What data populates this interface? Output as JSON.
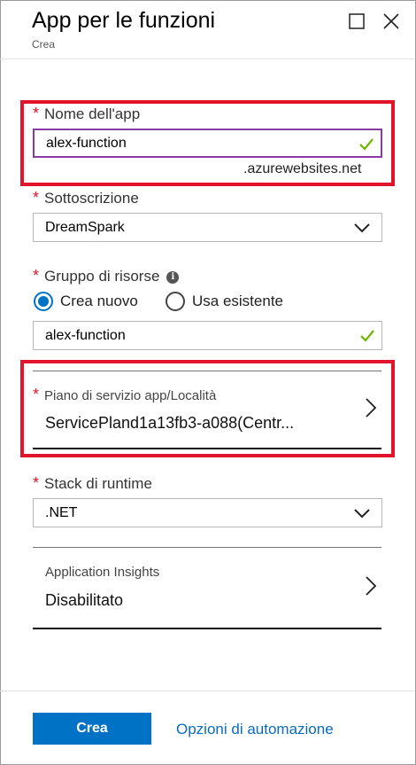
{
  "header": {
    "title": "App per le funzioni",
    "subtitle": "Crea"
  },
  "form": {
    "app_name": {
      "label": "Nome dell'app",
      "value": "alex-function",
      "suffix": ".azurewebsites.net",
      "valid": true
    },
    "subscription": {
      "label": "Sottoscrizione",
      "value": "DreamSpark"
    },
    "resource_group": {
      "label": "Gruppo di risorse",
      "options": [
        "Crea nuovo",
        "Usa esistente"
      ],
      "selected": "Crea nuovo",
      "value": "alex-function",
      "valid": true
    },
    "service_plan": {
      "label": "Piano di servizio app/Località",
      "value": "ServicePland1a13fb3-a088(Centr..."
    },
    "runtime_stack": {
      "label": "Stack di runtime",
      "value": ".NET"
    },
    "app_insights": {
      "label": "Application Insights",
      "value": "Disabilitato"
    }
  },
  "footer": {
    "create_label": "Crea",
    "automation_label": "Opzioni di automazione"
  },
  "colors": {
    "accent": "#0072c6",
    "required": "#e1142b",
    "highlight_box": "#e1142b",
    "valid_check": "#6bb700",
    "focused_border": "#8a3aa3"
  },
  "icons": [
    "maximize-icon",
    "close-icon",
    "checkmark-icon",
    "chevron-down-icon",
    "chevron-right-icon",
    "info-icon"
  ]
}
